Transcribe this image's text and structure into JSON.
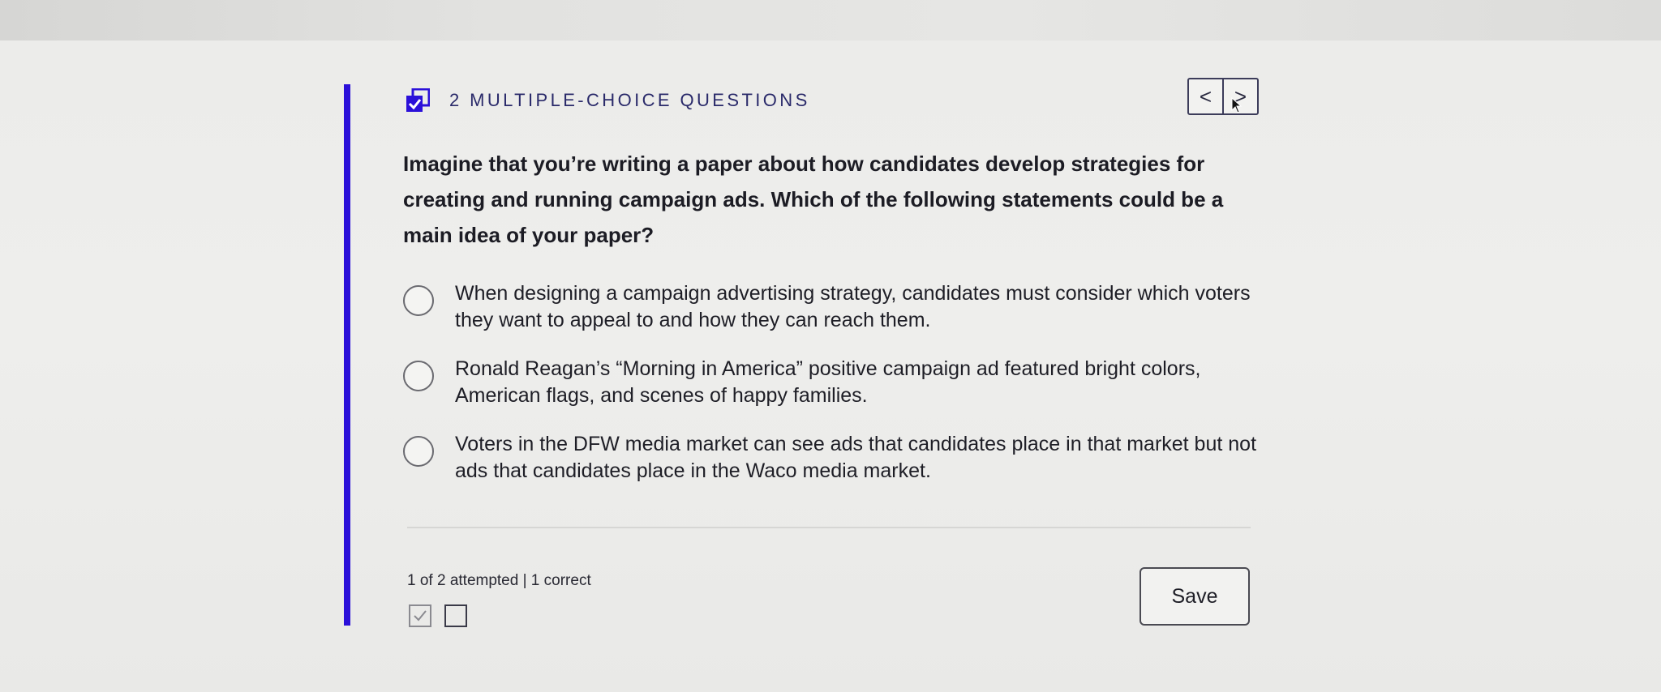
{
  "header": {
    "title": "2 MULTIPLE-CHOICE QUESTIONS",
    "icon": "checkbox-checked-icon",
    "prev_label": "<",
    "next_label": ">"
  },
  "question": {
    "text": "Imagine that you’re writing a paper about how candidates develop strategies for creating and running campaign ads. Which of the following statements could be a main idea of your paper?",
    "options": [
      {
        "text": "When designing a campaign advertising strategy, candidates must consider which voters they want to appeal to and how they can reach them.",
        "selected": false
      },
      {
        "text": "Ronald Reagan’s “Morning in America” positive campaign ad featured bright colors, American flags, and scenes of happy families.",
        "selected": false
      },
      {
        "text": "Voters in the DFW media market can see ads that candidates place in that market but not ads that candidates place in the Waco media market.",
        "selected": false
      }
    ]
  },
  "footer": {
    "progress_text": "1 of 2 attempted | 1 correct",
    "progress": [
      {
        "status": "correct"
      },
      {
        "status": "unattempted"
      }
    ],
    "save_label": "Save"
  },
  "colors": {
    "accent": "#2b10d9",
    "title": "#2a2a6a"
  }
}
